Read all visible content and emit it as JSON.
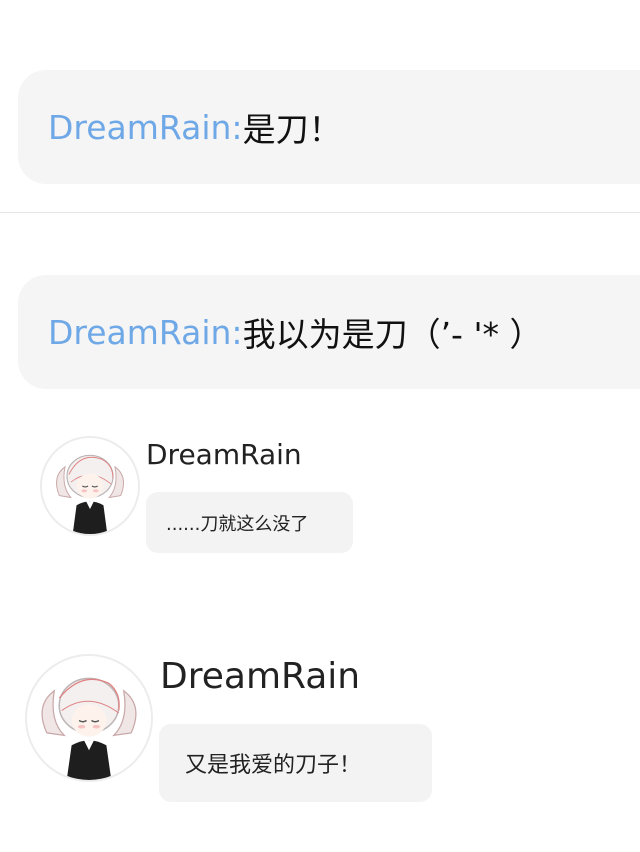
{
  "comments": [
    {
      "author": "DreamRain:",
      "text": "是刀！"
    },
    {
      "author": "DreamRain:",
      "text": "我以为是刀（’- '* ）"
    }
  ],
  "messages": [
    {
      "name": "DreamRain",
      "text": "......刀就这么没了",
      "avatar_icon": "anime-girl-avatar-icon"
    },
    {
      "name": "DreamRain",
      "text": "又是我爱的刀子！",
      "avatar_icon": "anime-girl-avatar-icon"
    }
  ]
}
